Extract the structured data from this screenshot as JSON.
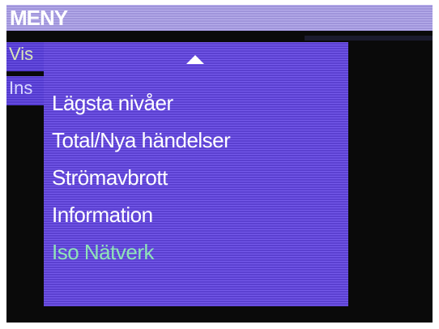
{
  "window": {
    "title": "MENY"
  },
  "parent_menu": {
    "items": [
      {
        "label": "Vis"
      },
      {
        "label": "Ins"
      }
    ]
  },
  "submenu": {
    "scroll_indicator": "up-arrow-icon",
    "items": [
      {
        "label": "Lägsta nivåer"
      },
      {
        "label": "Total/Nya händelser"
      },
      {
        "label": "Strömavbrott"
      },
      {
        "label": "Information"
      },
      {
        "label": "Iso Nätverk",
        "selected": true
      }
    ]
  },
  "colors": {
    "title_bar": "#a99de8",
    "menu_background": "#6547e8",
    "menu_text": "#ffffff",
    "selected_text": "#8fe3b8",
    "screen_background": "#0a0a0a"
  }
}
